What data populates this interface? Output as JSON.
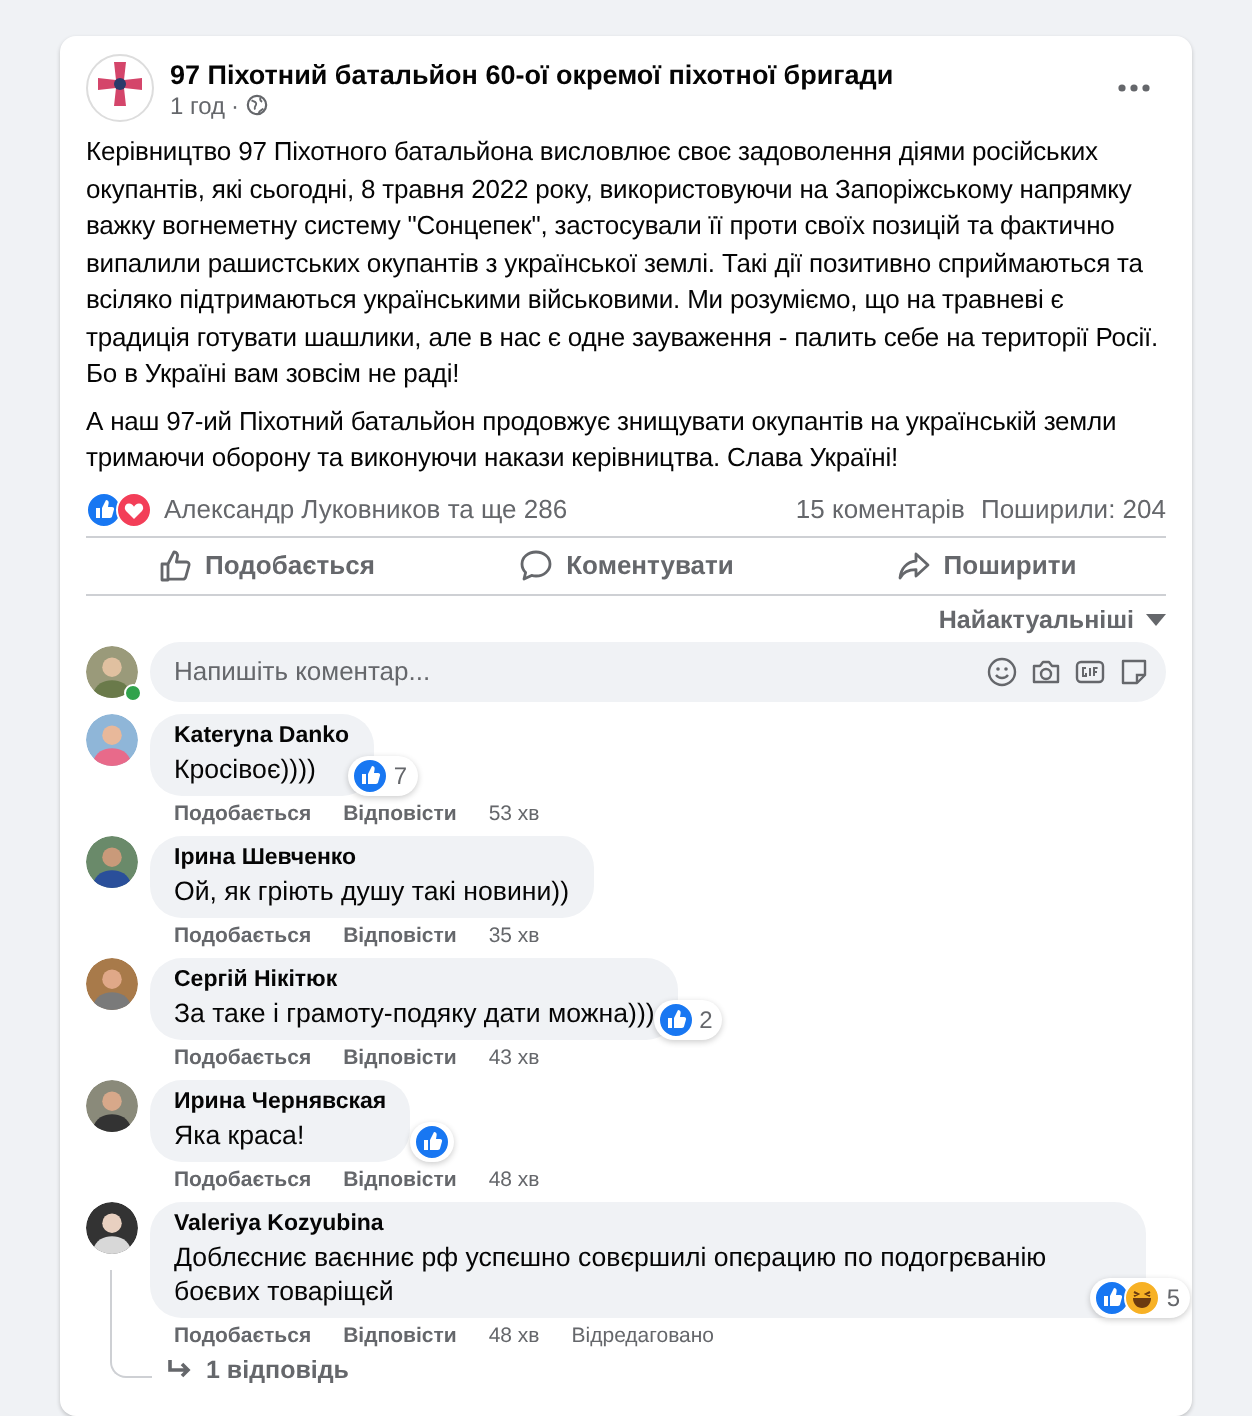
{
  "post": {
    "author": "97 Піхотний батальйон 60-ої окремої піхотної бригади",
    "time": "1 год",
    "dot": "·",
    "paragraphs": [
      "Керівництво 97 Піхотного батальйона висловлює своє задоволення діями російських окупантів, які сьогодні, 8 травня 2022 року, використовуючи на Запоріжському напрямку важку вогнеметну систему \"Сонцепек\", застосували її проти своїх позицій та фактично випалили рашистських окупантів з української землі. Такі дії позитивно сприймаються та всіляко підтримаються українськими військовими. Ми розуміємо, що на травневі є традиція готувати шашлики, але в нас є одне зауваження - палить себе на території Росії. Бо в Україні вам зовсім не раді!",
      "А наш 97-ий Піхотний батальйон продовжує знищувати окупантів на українській земли тримаючи оборону та виконуючи накази керівництва. Слава Україні!"
    ],
    "reaction_like": true,
    "reaction_love": true,
    "reacted_by": "Александр Луковников та ще 286",
    "comments_count": "15 коментарів",
    "shares": "Поширили: 204",
    "actions": [
      {
        "kind": "like",
        "label": "Подобається"
      },
      {
        "kind": "comment",
        "label": "Коментувати"
      },
      {
        "kind": "share",
        "label": "Поширити"
      }
    ],
    "sort": "Найактуальніші",
    "composer": {
      "placeholder": "Напишіть коментар...",
      "online": true
    },
    "comments": [
      {
        "author": "Kateryna Danko",
        "text": "Кросівоє))))",
        "reaction_like": true,
        "reaction_count": "7",
        "like": "Подобається",
        "reply": "Відповісти",
        "time": "53 хв"
      },
      {
        "author": "Ірина Шевченко",
        "text": "Ой, як гріють душу такі новини))",
        "like": "Подобається",
        "reply": "Відповісти",
        "time": "35 хв"
      },
      {
        "author": "Сергій Нікітюк",
        "text": "За таке і грамоту-подяку дати можна)))",
        "reaction_like": true,
        "reaction_count": "2",
        "like": "Подобається",
        "reply": "Відповісти",
        "time": "43 хв"
      },
      {
        "author": "Ирина Чернявская",
        "text": "Яка краса!",
        "reaction_like": true,
        "like": "Подобається",
        "reply": "Відповісти",
        "time": "48 хв"
      },
      {
        "author": "Valeriya Kozyubina",
        "text": "Доблєсниє ваєнниє рф успєшно совєршилі опєрацию по подогрєванію боєвих товаріщєй",
        "reaction_like": true,
        "reaction_haha": true,
        "reaction_count": "5",
        "like": "Подобається",
        "reply": "Відповісти",
        "time": "48 хв",
        "edited": "Відредаговано",
        "replies": "1 відповідь"
      }
    ]
  }
}
